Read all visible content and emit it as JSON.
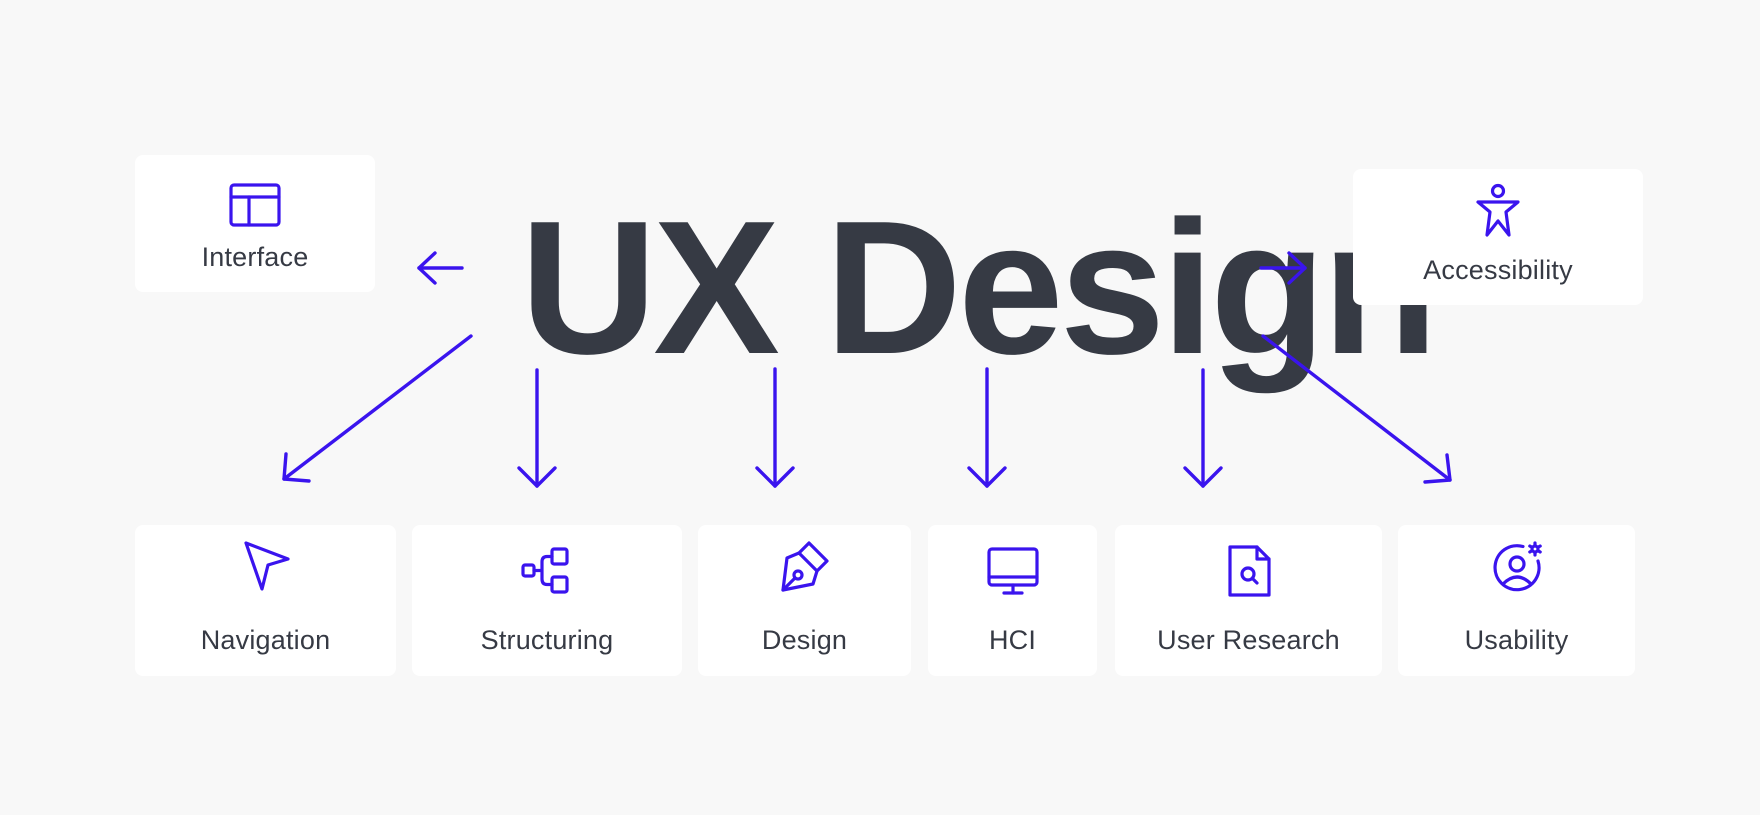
{
  "diagram": {
    "title": "UX Design",
    "accent_color": "#3a14ee",
    "text_color": "#363a44",
    "background_color": "#f8f8f8",
    "side_nodes": [
      {
        "id": "interface",
        "label": "Interface",
        "icon": "layout-icon",
        "direction": "left"
      },
      {
        "id": "accessibility",
        "label": "Accessibility",
        "icon": "accessibility-icon",
        "direction": "right"
      }
    ],
    "bottom_nodes": [
      {
        "id": "navigation",
        "label": "Navigation",
        "icon": "cursor-arrow-icon"
      },
      {
        "id": "structuring",
        "label": "Structuring",
        "icon": "hierarchy-icon"
      },
      {
        "id": "design",
        "label": "Design",
        "icon": "pen-tool-icon"
      },
      {
        "id": "hci",
        "label": "HCI",
        "icon": "monitor-icon"
      },
      {
        "id": "user-research",
        "label": "User Research",
        "icon": "file-search-icon"
      },
      {
        "id": "usability",
        "label": "Usability",
        "icon": "user-settings-icon"
      }
    ],
    "edges": [
      {
        "from": "UX Design",
        "to": "Interface"
      },
      {
        "from": "UX Design",
        "to": "Accessibility"
      },
      {
        "from": "UX Design",
        "to": "Navigation"
      },
      {
        "from": "UX Design",
        "to": "Structuring"
      },
      {
        "from": "UX Design",
        "to": "Design"
      },
      {
        "from": "UX Design",
        "to": "HCI"
      },
      {
        "from": "UX Design",
        "to": "User Research"
      },
      {
        "from": "UX Design",
        "to": "Usability"
      }
    ]
  }
}
